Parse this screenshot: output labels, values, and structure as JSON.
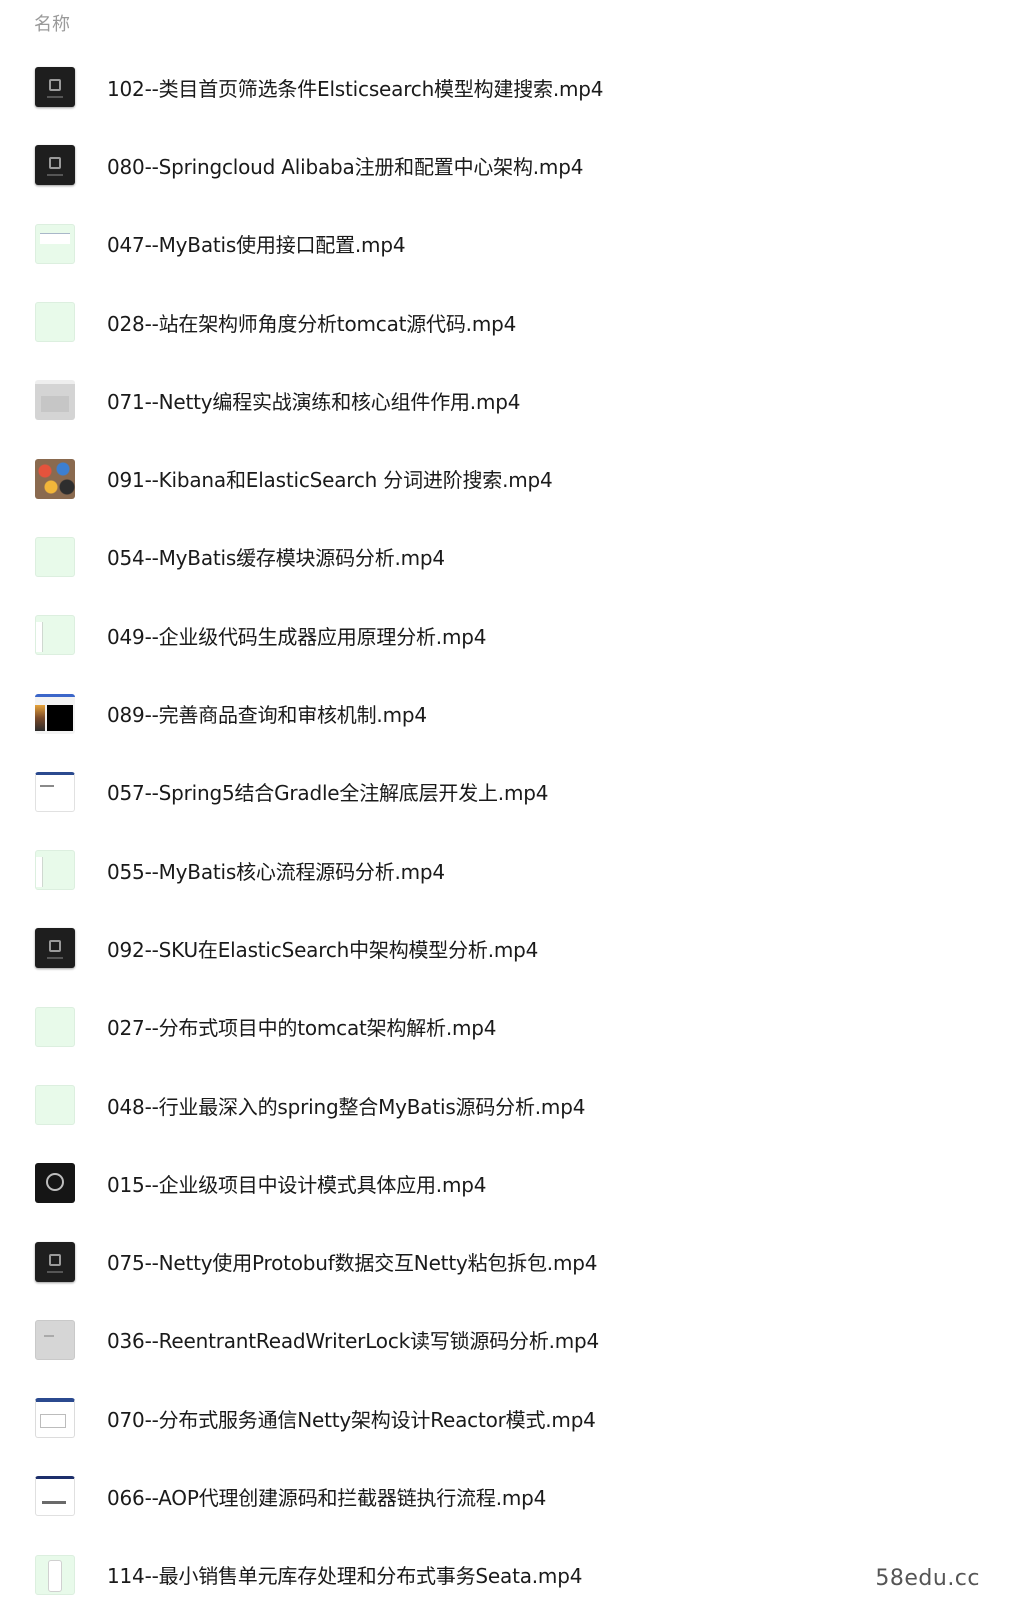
{
  "header": {
    "column_name": "名称"
  },
  "files": [
    {
      "name": "102--类目首页筛选条件Elsticsearch模型构建搜索.mp4",
      "thumb": "t-dark",
      "icon": "video-thumbnail-dark"
    },
    {
      "name": "080--Springcloud Alibaba注册和配置中心架构.mp4",
      "thumb": "t-dark",
      "icon": "video-thumbnail-dark"
    },
    {
      "name": "047--MyBatis使用接口配置.mp4",
      "thumb": "t-green-doc",
      "icon": "video-thumbnail-green"
    },
    {
      "name": "028--站在架构师角度分析tomcat源代码.mp4",
      "thumb": "t-green",
      "icon": "video-thumbnail-green"
    },
    {
      "name": "071--Netty编程实战演练和核心组件作用.mp4",
      "thumb": "t-gray",
      "icon": "video-thumbnail-gray"
    },
    {
      "name": "091--Kibana和ElasticSearch 分词进阶搜索.mp4",
      "thumb": "t-colorful",
      "icon": "video-thumbnail-colorful"
    },
    {
      "name": "054--MyBatis缓存模块源码分析.mp4",
      "thumb": "t-green",
      "icon": "video-thumbnail-green"
    },
    {
      "name": "049--企业级代码生成器应用原理分析.mp4",
      "thumb": "t-green-side",
      "icon": "video-thumbnail-green"
    },
    {
      "name": "089--完善商品查询和审核机制.mp4",
      "thumb": "t-screen-black",
      "icon": "video-thumbnail-screen"
    },
    {
      "name": "057--Spring5结合Gradle全注解底层开发上.mp4",
      "thumb": "t-white-blue",
      "icon": "video-thumbnail-white"
    },
    {
      "name": "055--MyBatis核心流程源码分析.mp4",
      "thumb": "t-green-side",
      "icon": "video-thumbnail-green"
    },
    {
      "name": "092--SKU在ElasticSearch中架构模型分析.mp4",
      "thumb": "t-dark",
      "icon": "video-thumbnail-dark"
    },
    {
      "name": "027--分布式项目中的tomcat架构解析.mp4",
      "thumb": "t-green",
      "icon": "video-thumbnail-green"
    },
    {
      "name": "048--行业最深入的spring整合MyBatis源码分析.mp4",
      "thumb": "t-green",
      "icon": "video-thumbnail-green"
    },
    {
      "name": "015--企业级项目中设计模式具体应用.mp4",
      "thumb": "t-dark-logo",
      "icon": "video-thumbnail-dark"
    },
    {
      "name": "075--Netty使用Protobuf数据交互Netty粘包拆包.mp4",
      "thumb": "t-dark",
      "icon": "video-thumbnail-dark"
    },
    {
      "name": "036--ReentrantReadWriterLock读写锁源码分析.mp4",
      "thumb": "t-gray-plain",
      "icon": "video-thumbnail-gray"
    },
    {
      "name": "070--分布式服务通信Netty架构设计Reactor模式.mp4",
      "thumb": "t-white-doc",
      "icon": "video-thumbnail-white"
    },
    {
      "name": "066--AOP代理创建源码和拦截器链执行流程.mp4",
      "thumb": "t-white-text",
      "icon": "video-thumbnail-white"
    },
    {
      "name": "114--最小销售单元库存处理和分布式事务Seata.mp4",
      "thumb": "t-green-phone",
      "icon": "video-thumbnail-green"
    }
  ],
  "watermark": "58edu.cc"
}
